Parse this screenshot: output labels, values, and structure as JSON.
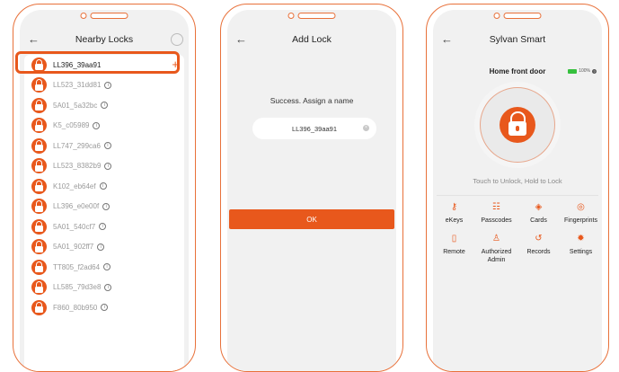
{
  "screen1": {
    "title": "Nearby Locks",
    "back_icon": "arrow-left-icon",
    "locks": [
      {
        "name": "LL396_39aa91",
        "selected": true
      },
      {
        "name": "LL523_31dd81"
      },
      {
        "name": "5A01_5a32bc"
      },
      {
        "name": "K5_c05989"
      },
      {
        "name": "LL747_299ca6"
      },
      {
        "name": "LL523_8382b9"
      },
      {
        "name": "K102_eb64ef"
      },
      {
        "name": "LL396_e0e00f"
      },
      {
        "name": "5A01_540cf7"
      },
      {
        "name": "5A01_902ff7"
      },
      {
        "name": "TT805_f2ad64"
      },
      {
        "name": "LL585_79d3e8"
      },
      {
        "name": "F860_80b950"
      }
    ]
  },
  "screen2": {
    "title": "Add Lock",
    "message": "Success. Assign a name",
    "lock_name_value": "LL396_39aa91",
    "ok_label": "OK"
  },
  "screen3": {
    "title": "Sylvan Smart",
    "door_name": "Home front door",
    "battery": "100%",
    "touch_hint": "Touch to Unlock, Hold to Lock",
    "menu": [
      {
        "label": "eKeys",
        "icon": "ekey-icon"
      },
      {
        "label": "Passcodes",
        "icon": "passcode-icon"
      },
      {
        "label": "Cards",
        "icon": "card-icon"
      },
      {
        "label": "Fingerprints",
        "icon": "fingerprint-icon"
      },
      {
        "label": "Remote",
        "icon": "remote-icon"
      },
      {
        "label": "Authorized Admin",
        "icon": "admin-icon"
      },
      {
        "label": "Records",
        "icon": "records-icon"
      },
      {
        "label": "Settings",
        "icon": "settings-icon"
      }
    ]
  },
  "colors": {
    "accent": "#e8581c",
    "frame": "#e8713a",
    "battery": "#36c03e"
  }
}
